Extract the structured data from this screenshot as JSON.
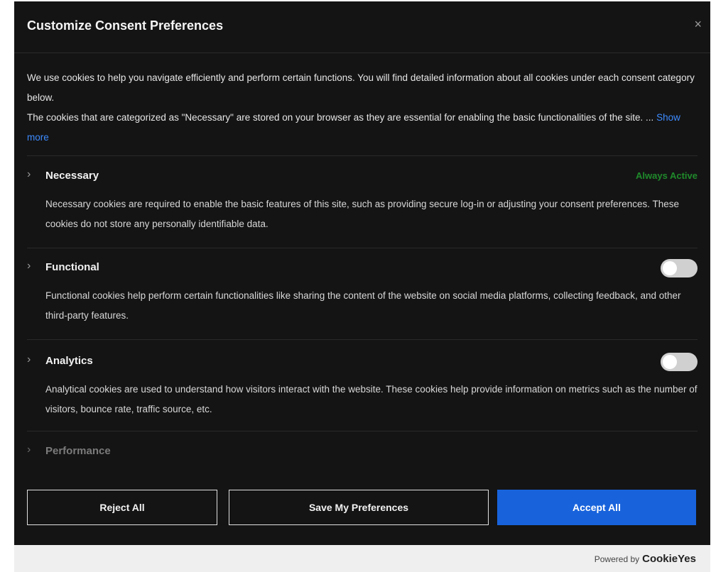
{
  "modal": {
    "title": "Customize Consent Preferences",
    "close_symbol": "×"
  },
  "intro": {
    "line1": "We use cookies to help you navigate efficiently and perform certain functions. You will find detailed information about all cookies under each consent category below.",
    "line2": "The cookies that are categorized as \"Necessary\" are stored on your browser as they are essential for enabling the basic functionalities of the site. ...",
    "show_more": "Show more"
  },
  "categories": [
    {
      "title": "Necessary",
      "status": "Always Active",
      "description": "Necessary cookies are required to enable the basic features of this site, such as providing secure log-in or adjusting your consent preferences. These cookies do not store any personally identifiable data."
    },
    {
      "title": "Functional",
      "toggle": "off",
      "description": "Functional cookies help perform certain functionalities like sharing the content of the website on social media platforms, collecting feedback, and other third-party features."
    },
    {
      "title": "Analytics",
      "toggle": "off",
      "description": "Analytical cookies are used to understand how visitors interact with the website. These cookies help provide information on metrics such as the number of visitors, bounce rate, traffic source, etc."
    },
    {
      "title": "Performance"
    }
  ],
  "buttons": {
    "reject": "Reject All",
    "save": "Save My Preferences",
    "accept": "Accept All"
  },
  "footer": {
    "powered_by": "Powered by",
    "brand": "CookieYes"
  },
  "colors": {
    "background": "#141414",
    "accent": "#1863dc",
    "link": "#3d8bff",
    "active": "#1f8a2b"
  },
  "icons": {
    "chevron": "›"
  }
}
